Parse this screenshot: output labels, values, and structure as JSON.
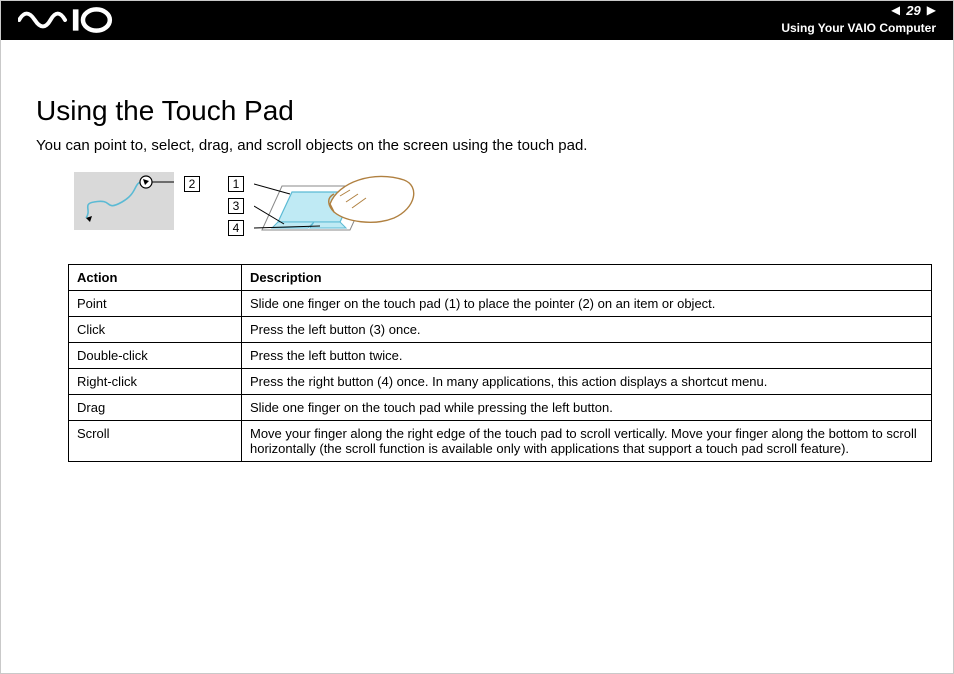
{
  "header": {
    "page_number": "29",
    "section": "Using Your VAIO Computer",
    "logo_label": "VAIO"
  },
  "page": {
    "title": "Using the Touch Pad",
    "intro": "You can point to, select, drag, and scroll objects on the screen using the touch pad."
  },
  "callouts": {
    "c1": "1",
    "c2": "2",
    "c3": "3",
    "c4": "4"
  },
  "table": {
    "head_action": "Action",
    "head_description": "Description",
    "rows": [
      {
        "action": "Point",
        "desc": "Slide one finger on the touch pad (1) to place the pointer (2) on an item or object."
      },
      {
        "action": "Click",
        "desc": "Press the left button (3) once."
      },
      {
        "action": "Double-click",
        "desc": "Press the left button twice."
      },
      {
        "action": "Right-click",
        "desc": "Press the right button (4) once. In many applications, this action displays a shortcut menu."
      },
      {
        "action": "Drag",
        "desc": "Slide one finger on the touch pad while pressing the left button."
      },
      {
        "action": "Scroll",
        "desc": "Move your finger along the right edge of the touch pad to scroll vertically. Move your finger along the bottom to scroll horizontally (the scroll function is available only with applications that support a touch pad scroll feature)."
      }
    ]
  }
}
